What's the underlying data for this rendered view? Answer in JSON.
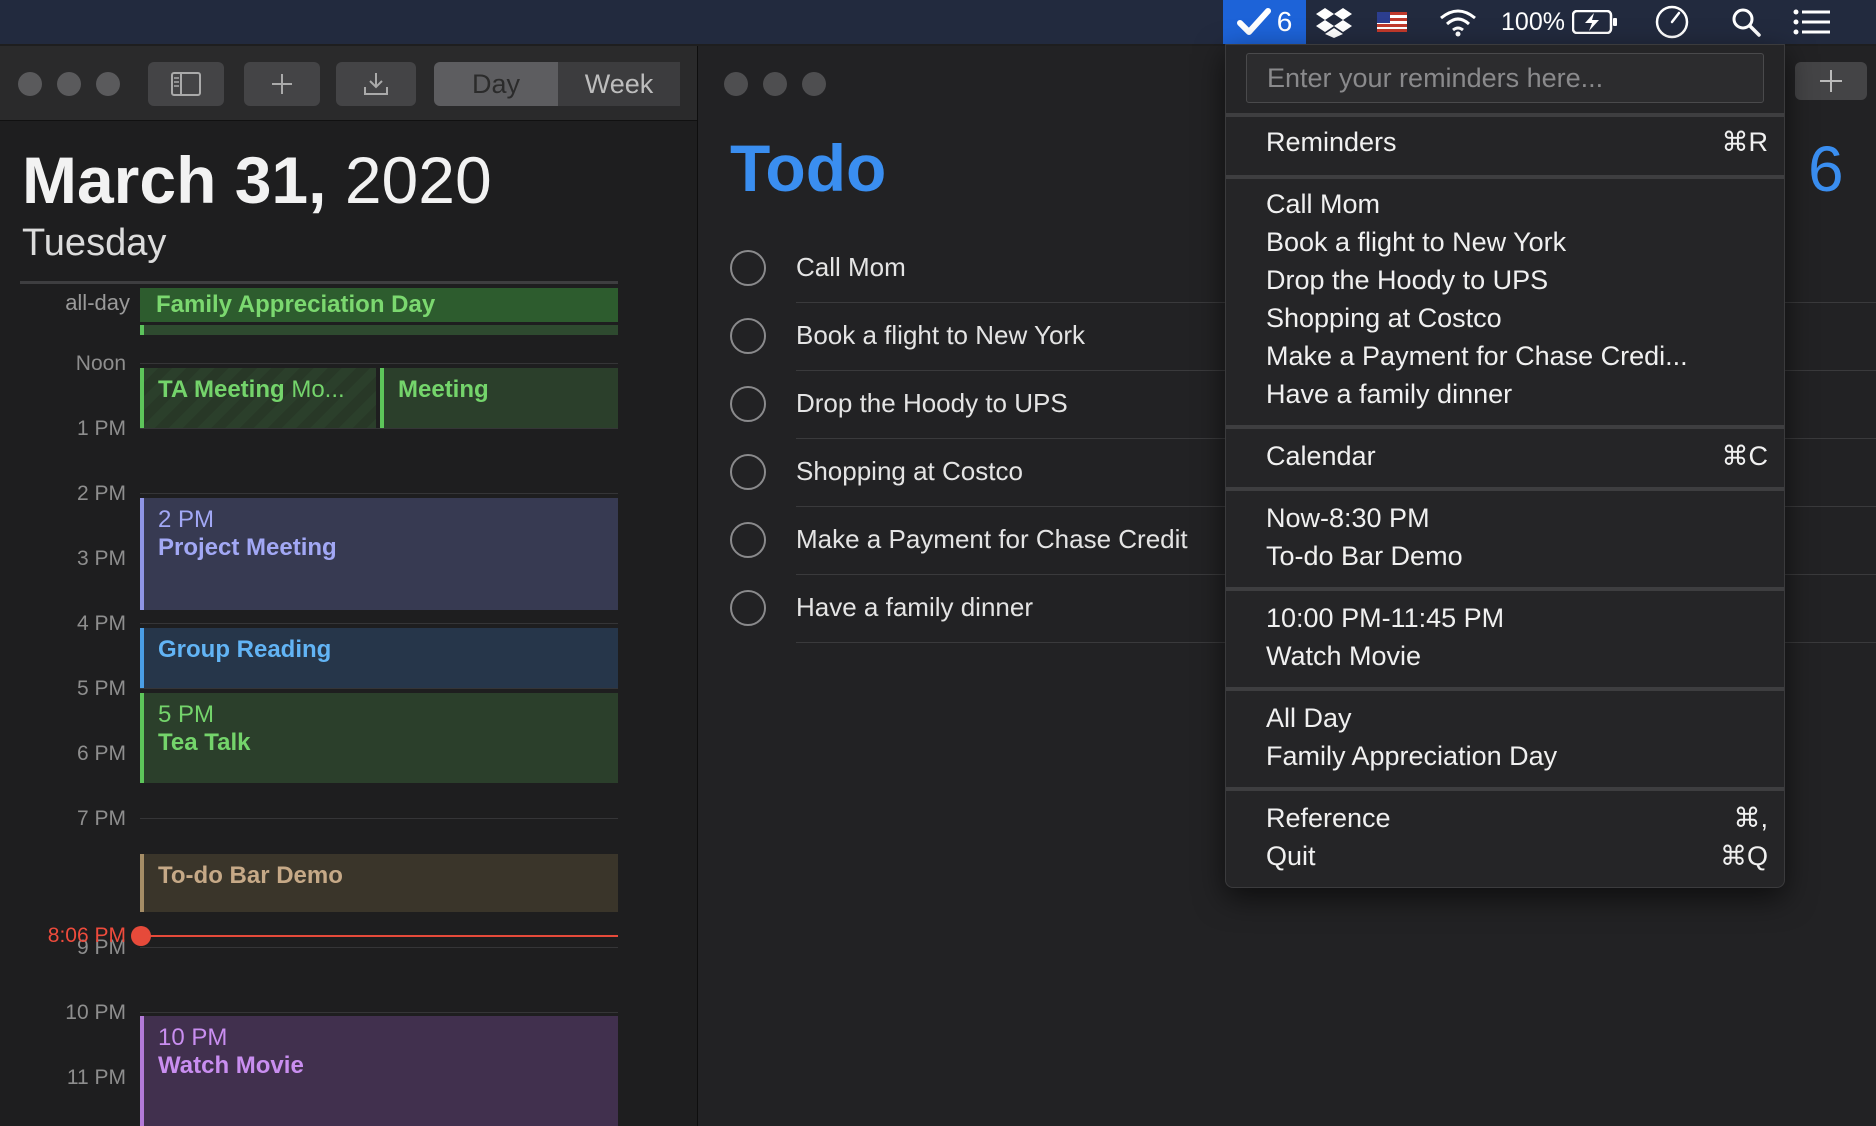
{
  "menubar": {
    "todo_count": "6",
    "battery": "100%",
    "colors": {
      "bar_bg": "#222a3e",
      "highlight": "#1d63d8"
    }
  },
  "calendar": {
    "toolbar": {
      "day_label": "Day",
      "week_label": "Week"
    },
    "date_bold": "March 31,",
    "date_year": " 2020",
    "weekday": "Tuesday",
    "allday_label": "all-day",
    "allday_event": "Family Appreciation Day",
    "hours": [
      "Noon",
      "1 PM",
      "2 PM",
      "3 PM",
      "4 PM",
      "5 PM",
      "6 PM",
      "7 PM",
      "9 PM",
      "10 PM",
      "11 PM"
    ],
    "now_label": "8:06 PM",
    "events": {
      "ta_meeting": {
        "name": "TA Meeting",
        "extra": "Mo..."
      },
      "meeting": {
        "name": "Meeting"
      },
      "project_meeting": {
        "time": "2 PM",
        "name": "Project Meeting"
      },
      "group_reading": {
        "name": "Group Reading"
      },
      "tea_talk": {
        "time": "5 PM",
        "name": "Tea Talk"
      },
      "todo_demo": {
        "name": "To-do Bar Demo"
      },
      "watch_movie": {
        "time": "10 PM",
        "name": "Watch Movie"
      }
    }
  },
  "todo": {
    "title": "Todo",
    "count": "6",
    "items": [
      "Call Mom",
      "Book a flight to New York",
      "Drop the Hoody to UPS",
      "Shopping at Costco",
      "Make a Payment for Chase Credit",
      "Have a family dinner"
    ],
    "accent": "#3a8ef0"
  },
  "menu": {
    "input_placeholder": "Enter your reminders here...",
    "reminders": {
      "label": "Reminders",
      "shortcut": "⌘R"
    },
    "items": [
      "Call Mom",
      "Book a flight to New York",
      "Drop the Hoody to UPS",
      "Shopping at Costco",
      "Make a Payment for Chase Credi...",
      "Have a family dinner"
    ],
    "calendar": {
      "label": "Calendar",
      "shortcut": "⌘C"
    },
    "events": [
      {
        "time": "Now-8:30 PM",
        "name": "To-do Bar Demo"
      },
      {
        "time": "10:00 PM-11:45 PM",
        "name": "Watch Movie"
      },
      {
        "time": "All Day",
        "name": "Family Appreciation Day"
      }
    ],
    "reference": {
      "label": "Reference",
      "shortcut": "⌘,"
    },
    "quit": {
      "label": "Quit",
      "shortcut": "⌘Q"
    }
  }
}
